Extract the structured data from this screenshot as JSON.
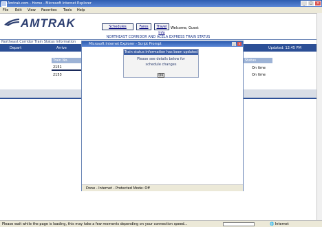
{
  "window": {
    "title": "Amtrak.com - Home - Microsoft Internet Explorer"
  },
  "menu": [
    "File",
    "Edit",
    "View",
    "Favorites",
    "Tools",
    "Help"
  ],
  "brand": {
    "logo_text": "AMTRAK"
  },
  "nav": {
    "schedules": "Schedules",
    "fares": "Fares",
    "travel": "Travel Info"
  },
  "welcome": "Welcome, Guest",
  "banner": "NORTHEAST CORRIDOR AND ACELA EXPRESS TRAIN STATUS",
  "band": {
    "left": "Northeast Corridor Train Status Information",
    "dep": "Depart",
    "arr": "Arrive",
    "upd": "Updated: 12:45 PM"
  },
  "table": {
    "col1": "Train No.",
    "row1": "2151",
    "row2": "2153",
    "col2": "Status",
    "s1": "On time",
    "s2": "On time"
  },
  "dialog": {
    "title": "Microsoft Internet Explorer - Script Prompt",
    "header": "Train status information has been updated",
    "line1": "Please see details below for",
    "line2": "schedule changes",
    "ok": "OK",
    "status": "Done - Internet - Protected Mode: Off"
  },
  "status": {
    "message": "Please wait while the page is loading, this may take a few moments depending on your connection speed...",
    "zone": "Internet"
  }
}
